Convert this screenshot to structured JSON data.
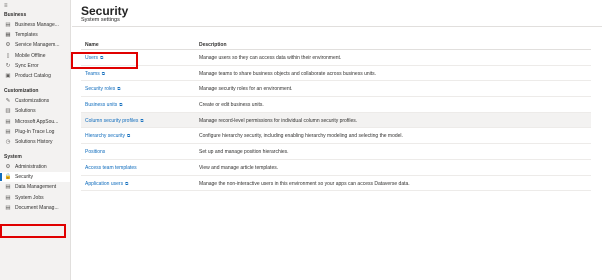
{
  "sidebar": {
    "sections": [
      {
        "label": "Business",
        "items": [
          {
            "label": "Business Manage...",
            "icon": "business-management-icon",
            "glyph": "▤"
          },
          {
            "label": "Templates",
            "icon": "templates-icon",
            "glyph": "▦"
          },
          {
            "label": "Service Managem...",
            "icon": "service-management-icon",
            "glyph": "⚙"
          },
          {
            "label": "Mobile Offline",
            "icon": "mobile-offline-icon",
            "glyph": "▯"
          },
          {
            "label": "Sync Error",
            "icon": "sync-error-icon",
            "glyph": "↻"
          },
          {
            "label": "Product Catalog",
            "icon": "product-catalog-icon",
            "glyph": "▣"
          }
        ]
      },
      {
        "label": "Customization",
        "items": [
          {
            "label": "Customizations",
            "icon": "customizations-icon",
            "glyph": "✎"
          },
          {
            "label": "Solutions",
            "icon": "solutions-icon",
            "glyph": "▥"
          },
          {
            "label": "Microsoft AppSou...",
            "icon": "appsource-icon",
            "glyph": "▤"
          },
          {
            "label": "Plug-In Trace Log",
            "icon": "trace-log-icon",
            "glyph": "▤"
          },
          {
            "label": "Solutions History",
            "icon": "solutions-history-icon",
            "glyph": "◷"
          }
        ]
      },
      {
        "label": "System",
        "items": [
          {
            "label": "Administration",
            "icon": "administration-icon",
            "glyph": "⚙"
          },
          {
            "label": "Security",
            "icon": "security-icon",
            "glyph": "🔒",
            "selected": true
          },
          {
            "label": "Data Management",
            "icon": "data-management-icon",
            "glyph": "▤"
          },
          {
            "label": "System Jobs",
            "icon": "system-jobs-icon",
            "glyph": "▤"
          },
          {
            "label": "Document Manag...",
            "icon": "document-management-icon",
            "glyph": "▤"
          }
        ]
      }
    ]
  },
  "header": {
    "title": "Security",
    "subtitle": "System settings"
  },
  "table": {
    "columns": {
      "name": "Name",
      "description": "Description"
    },
    "external_glyph": "⧉",
    "rows": [
      {
        "name": "Users",
        "description": "Manage users so they can access data within their environment.",
        "highlighted": true
      },
      {
        "name": "Teams",
        "description": "Manage teams to share business objects and collaborate across business units."
      },
      {
        "name": "Security roles",
        "description": "Manage security roles for an environment."
      },
      {
        "name": "Business units",
        "description": "Create or edit business units."
      },
      {
        "name": "Column security profiles",
        "description": "Manage record-level permissions for individual column security profiles.",
        "shaded": true
      },
      {
        "name": "Hierarchy security",
        "description": "Configure hierarchy security, including enabling hierarchy modeling and selecting the model."
      },
      {
        "name": "Positions",
        "description": "Set up and manage position hierarchies.",
        "no_external": true
      },
      {
        "name": "Access team templates",
        "description": "View and manage article templates.",
        "no_external": true
      },
      {
        "name": "Application users",
        "description": "Manage the non-interactive users in this environment so your apps can access Dataverse data."
      }
    ]
  }
}
